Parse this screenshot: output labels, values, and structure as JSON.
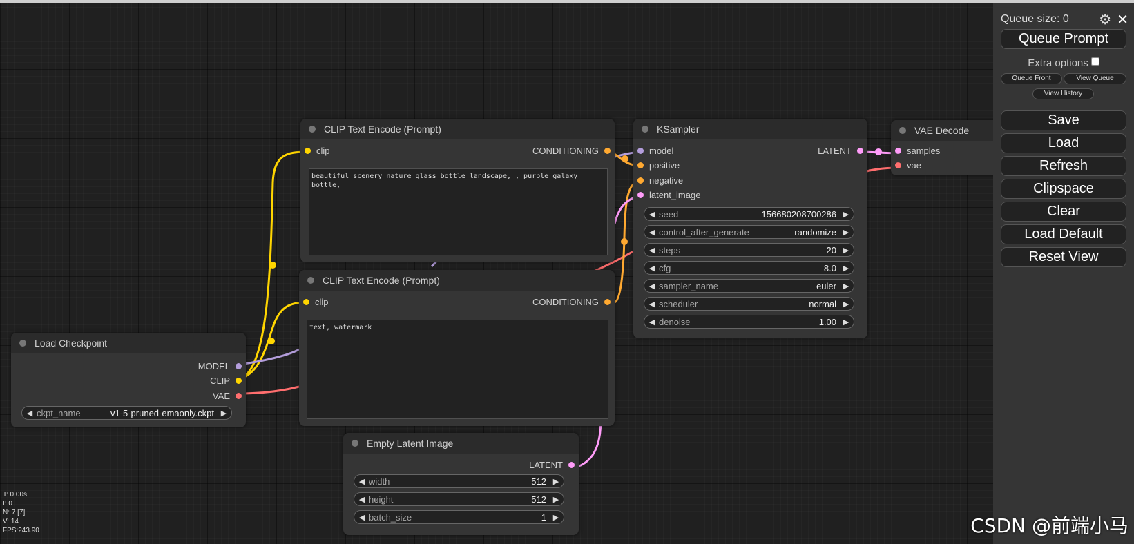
{
  "colors": {
    "clip": "#ffd500",
    "conditioning": "#ffa931",
    "model": "#b39ddb",
    "vae": "#ff6e6e",
    "latent": "#ff9cf9"
  },
  "nodes": {
    "clip_pos": {
      "title": "CLIP Text Encode (Prompt)",
      "input": "clip",
      "output": "CONDITIONING",
      "text": "beautiful scenery nature glass bottle landscape, , purple galaxy\nbottle,"
    },
    "clip_neg": {
      "title": "CLIP Text Encode (Prompt)",
      "input": "clip",
      "output": "CONDITIONING",
      "text": "text, watermark"
    },
    "ksampler": {
      "title": "KSampler",
      "inputs": [
        "model",
        "positive",
        "negative",
        "latent_image"
      ],
      "output": "LATENT",
      "widgets": [
        {
          "label": "seed",
          "value": "156680208700286"
        },
        {
          "label": "control_after_generate",
          "value": "randomize"
        },
        {
          "label": "steps",
          "value": "20"
        },
        {
          "label": "cfg",
          "value": "8.0"
        },
        {
          "label": "sampler_name",
          "value": "euler"
        },
        {
          "label": "scheduler",
          "value": "normal"
        },
        {
          "label": "denoise",
          "value": "1.00"
        }
      ]
    },
    "vae_decode": {
      "title": "VAE Decode",
      "inputs": [
        "samples",
        "vae"
      ]
    },
    "load_checkpoint": {
      "title": "Load Checkpoint",
      "outputs": [
        "MODEL",
        "CLIP",
        "VAE"
      ],
      "widget": {
        "label": "ckpt_name",
        "value": "v1-5-pruned-emaonly.ckpt"
      }
    },
    "empty_latent": {
      "title": "Empty Latent Image",
      "output": "LATENT",
      "widgets": [
        {
          "label": "width",
          "value": "512"
        },
        {
          "label": "height",
          "value": "512"
        },
        {
          "label": "batch_size",
          "value": "1"
        }
      ]
    }
  },
  "panel": {
    "queue_size": "Queue size: 0",
    "queue_prompt": "Queue Prompt",
    "extra_options": "Extra options",
    "queue_front": "Queue Front",
    "view_queue": "View Queue",
    "view_history": "View History",
    "save": "Save",
    "load": "Load",
    "refresh": "Refresh",
    "clipspace": "Clipspace",
    "clear": "Clear",
    "load_default": "Load Default",
    "reset_view": "Reset View"
  },
  "stats": {
    "t": "T: 0.00s",
    "i": "I: 0",
    "n": "N: 7 [7]",
    "v": "V: 14",
    "fps": "FPS:243.90"
  },
  "watermark": "CSDN @前端小马"
}
